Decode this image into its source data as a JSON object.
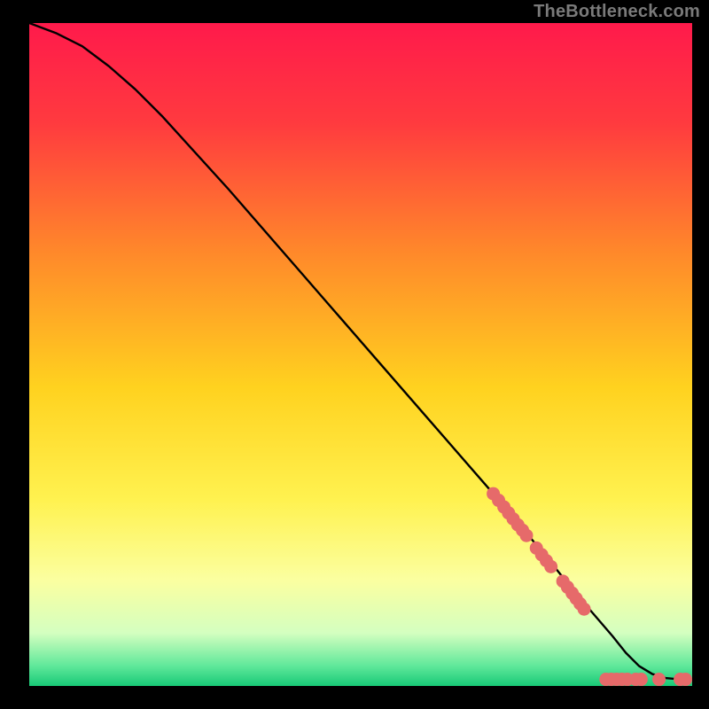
{
  "attribution": "TheBottleneck.com",
  "chart_data": {
    "type": "line",
    "title": "",
    "xlabel": "",
    "ylabel": "",
    "xlim": [
      0,
      100
    ],
    "ylim": [
      0,
      100
    ],
    "background_gradient": {
      "stops": [
        {
          "offset": 0.0,
          "color": "#ff1a4b"
        },
        {
          "offset": 0.15,
          "color": "#ff3a3f"
        },
        {
          "offset": 0.35,
          "color": "#ff8a2a"
        },
        {
          "offset": 0.55,
          "color": "#ffd21f"
        },
        {
          "offset": 0.72,
          "color": "#fff250"
        },
        {
          "offset": 0.84,
          "color": "#fbffa0"
        },
        {
          "offset": 0.92,
          "color": "#d4ffc0"
        },
        {
          "offset": 0.97,
          "color": "#5fe89a"
        },
        {
          "offset": 1.0,
          "color": "#18c977"
        }
      ]
    },
    "curve": {
      "x": [
        0,
        4,
        8,
        12,
        16,
        20,
        30,
        40,
        50,
        60,
        70,
        78,
        82,
        85,
        88,
        90,
        92,
        94,
        96,
        98,
        100
      ],
      "y": [
        100,
        98.5,
        96.5,
        93.5,
        90,
        86,
        75,
        63.5,
        52,
        40.5,
        29,
        19.5,
        14.5,
        11,
        7.5,
        5,
        3,
        1.8,
        1.2,
        1.0,
        1.0
      ]
    },
    "markers": [
      {
        "x": 70.0,
        "y": 29.0
      },
      {
        "x": 70.8,
        "y": 28.0
      },
      {
        "x": 71.6,
        "y": 27.0
      },
      {
        "x": 72.3,
        "y": 26.1
      },
      {
        "x": 73.0,
        "y": 25.2
      },
      {
        "x": 73.7,
        "y": 24.3
      },
      {
        "x": 74.4,
        "y": 23.5
      },
      {
        "x": 75.0,
        "y": 22.7
      },
      {
        "x": 76.5,
        "y": 20.8
      },
      {
        "x": 77.3,
        "y": 19.8
      },
      {
        "x": 78.0,
        "y": 18.9
      },
      {
        "x": 78.7,
        "y": 18.0
      },
      {
        "x": 80.5,
        "y": 15.8
      },
      {
        "x": 81.2,
        "y": 14.9
      },
      {
        "x": 81.9,
        "y": 14.0
      },
      {
        "x": 82.5,
        "y": 13.2
      },
      {
        "x": 83.1,
        "y": 12.4
      },
      {
        "x": 83.7,
        "y": 11.6
      },
      {
        "x": 87.0,
        "y": 1.0
      },
      {
        "x": 87.8,
        "y": 1.0
      },
      {
        "x": 88.6,
        "y": 1.0
      },
      {
        "x": 89.4,
        "y": 1.0
      },
      {
        "x": 90.2,
        "y": 1.0
      },
      {
        "x": 91.5,
        "y": 1.0
      },
      {
        "x": 92.3,
        "y": 1.0
      },
      {
        "x": 95.0,
        "y": 1.0
      },
      {
        "x": 98.2,
        "y": 1.0
      },
      {
        "x": 99.0,
        "y": 1.0
      }
    ],
    "marker_color": "#e66a6a",
    "curve_color": "#000000"
  }
}
